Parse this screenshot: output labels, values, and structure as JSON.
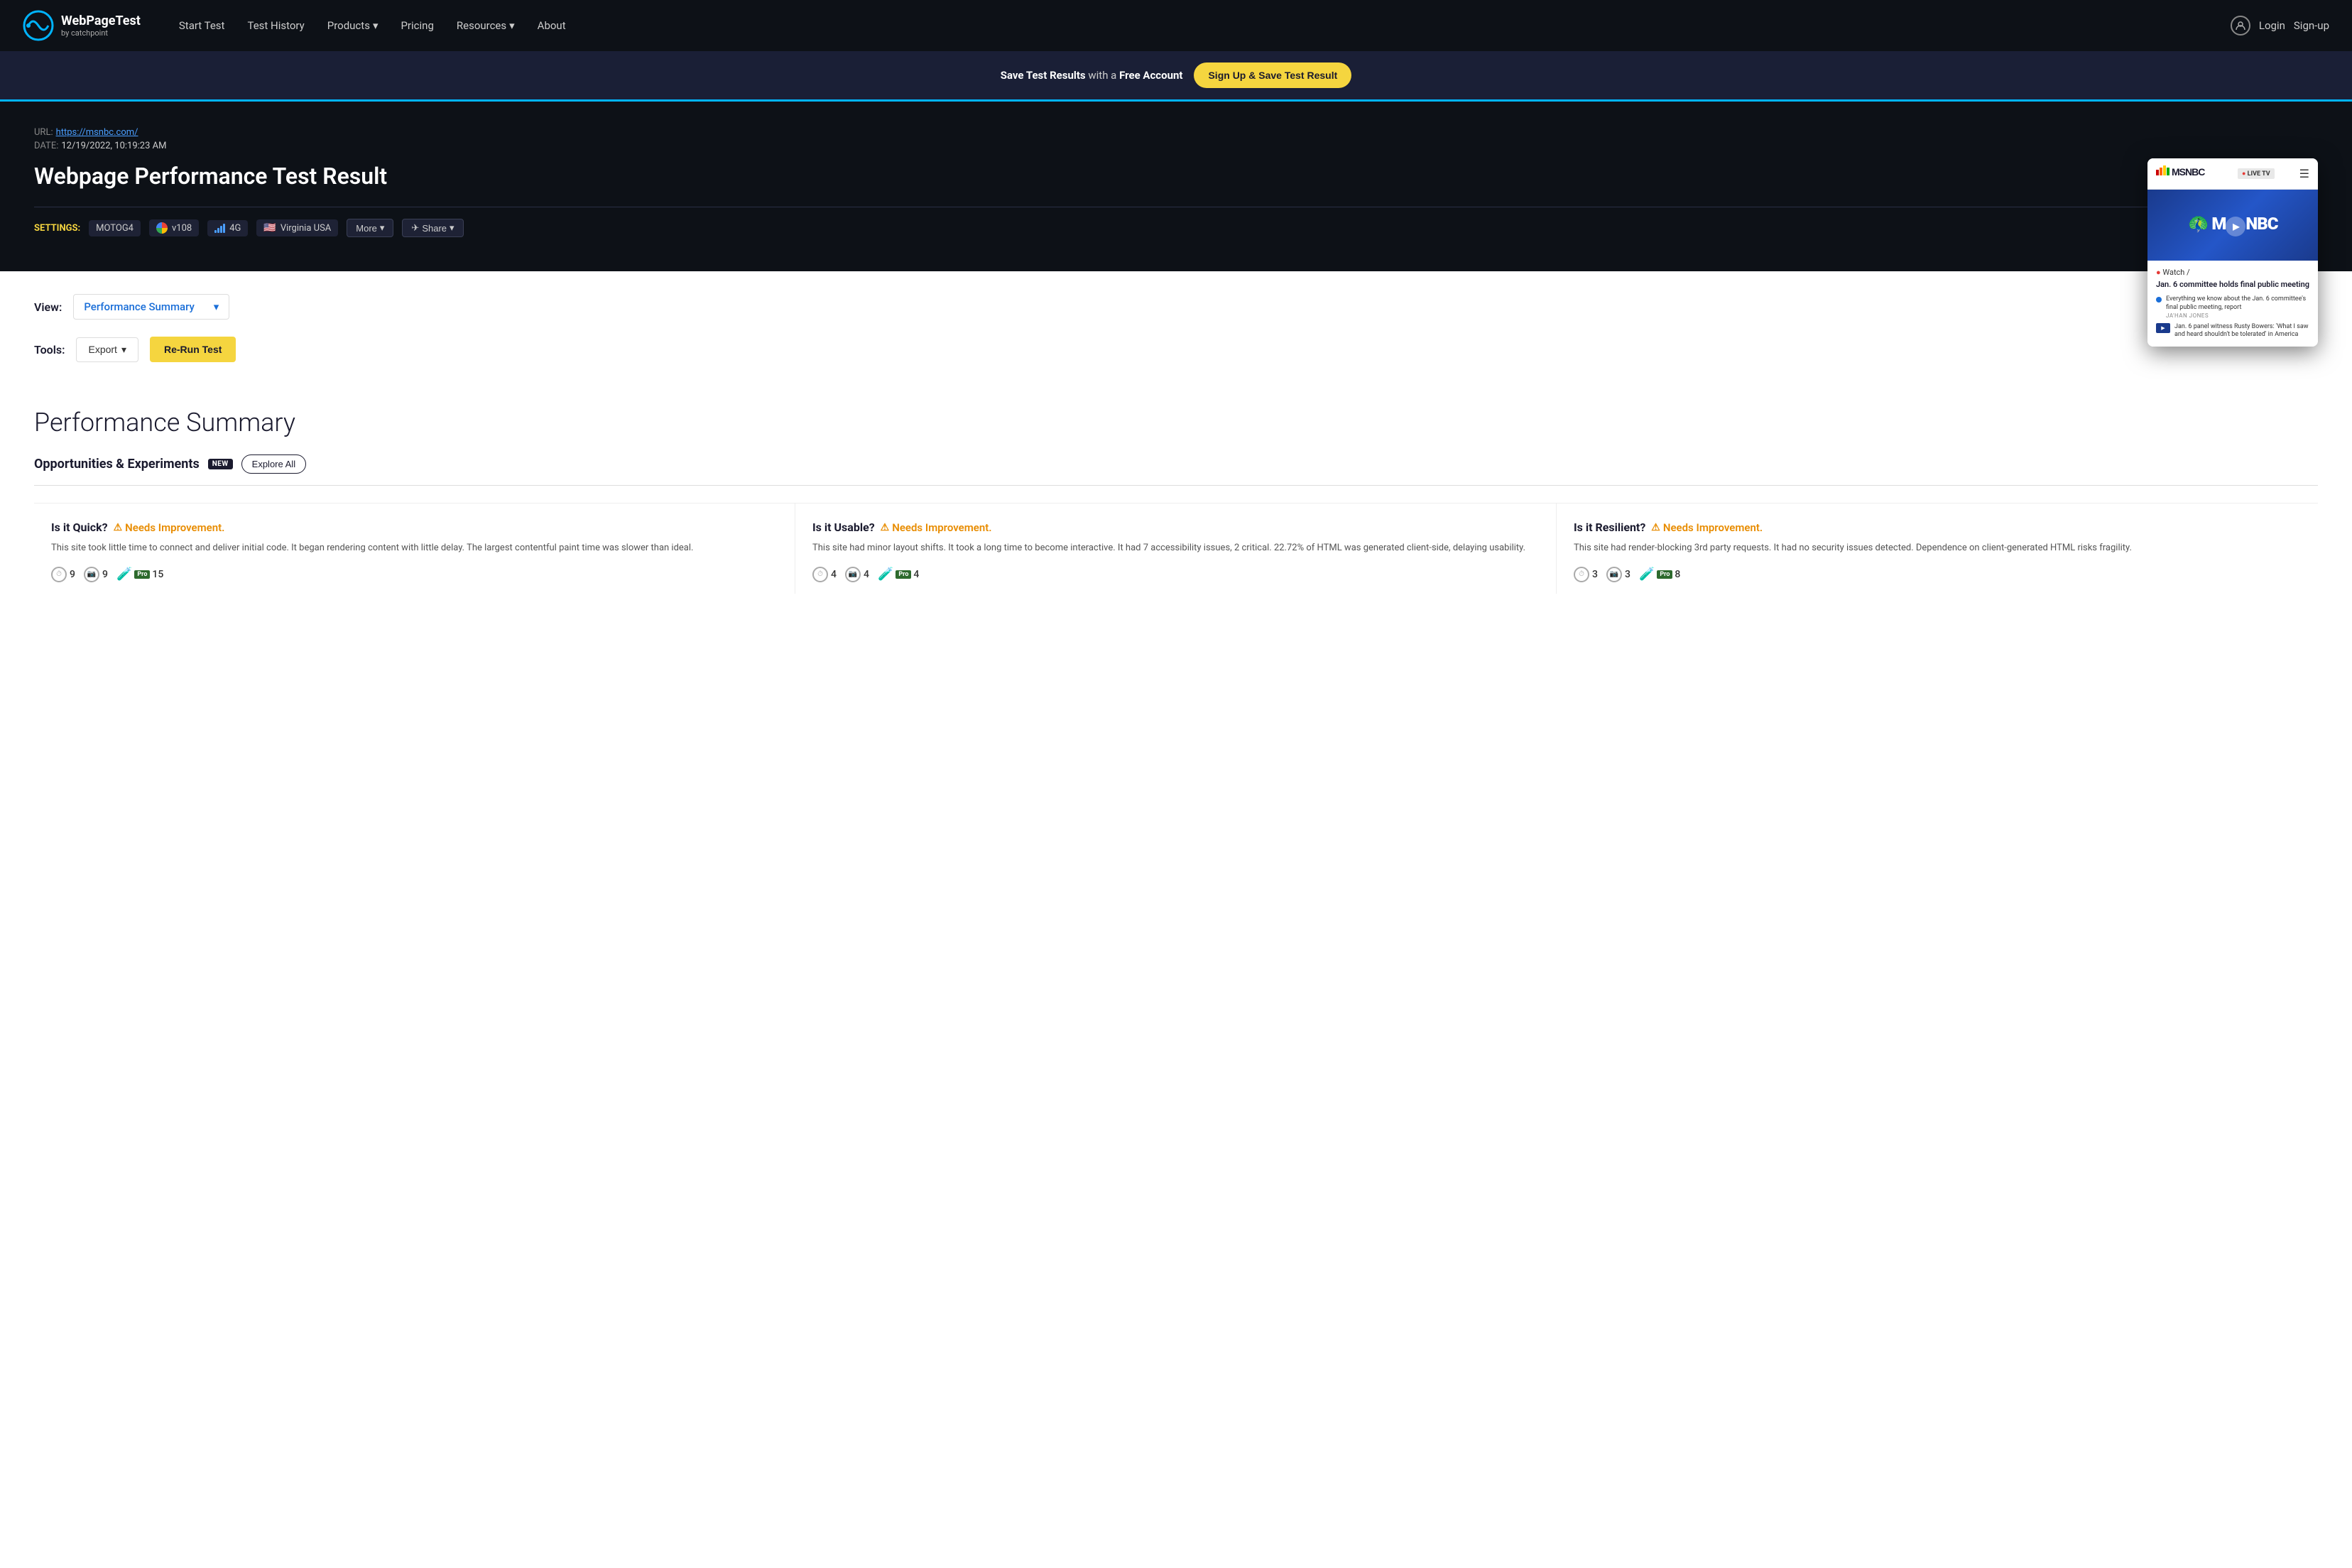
{
  "navbar": {
    "brand": "WebPageTest",
    "sub": "by catchpoint",
    "links": [
      {
        "label": "Start Test",
        "id": "start-test",
        "hasDropdown": false
      },
      {
        "label": "Test History",
        "id": "test-history",
        "hasDropdown": false
      },
      {
        "label": "Products",
        "id": "products",
        "hasDropdown": true
      },
      {
        "label": "Pricing",
        "id": "pricing",
        "hasDropdown": false
      },
      {
        "label": "Resources",
        "id": "resources",
        "hasDropdown": true
      },
      {
        "label": "About",
        "id": "about",
        "hasDropdown": false
      }
    ],
    "login_label": "Login",
    "signup_label": "Sign-up"
  },
  "banner": {
    "text_pre": "Save Test Results",
    "text_mid": " with a ",
    "text_bold": "Free Account",
    "btn_label": "Sign Up & Save Test Result"
  },
  "test_result": {
    "url_label": "URL:",
    "url_value": "https://msnbc.com/",
    "date_label": "DATE:",
    "date_value": "12/19/2022, 10:19:23 AM",
    "page_title": "Webpage Performance Test Result",
    "settings_label": "SETTINGS:",
    "device": "MOTOG4",
    "browser_version": "v108",
    "connection": "4G",
    "location": "Virginia USA",
    "more_label": "More",
    "share_label": "Share"
  },
  "view_section": {
    "view_label": "View:",
    "view_selected": "Performance Summary",
    "tools_label": "Tools:",
    "export_label": "Export",
    "rerun_label": "Re-Run Test"
  },
  "performance_summary": {
    "title": "Performance Summary",
    "opportunities_title": "Opportunities & Experiments",
    "new_badge": "NEW",
    "explore_btn": "Explore All",
    "cards": [
      {
        "title": "Is it Quick?",
        "status": "Needs Improvement.",
        "description": "This site took little time to connect and deliver initial code. It began rendering content with little delay. The largest contentful paint time was slower than ideal.",
        "metrics": [
          {
            "icon": "⏱",
            "count": "9"
          },
          {
            "icon": "📷",
            "count": "9"
          },
          {
            "icon": "🧪",
            "pro": true,
            "count": "15"
          }
        ]
      },
      {
        "title": "Is it Usable?",
        "status": "Needs Improvement.",
        "description": "This site had minor layout shifts. It took a long time to become interactive. It had 7 accessibility issues, 2 critical. 22.72% of HTML was generated client-side, delaying usability.",
        "metrics": [
          {
            "icon": "⏱",
            "count": "4"
          },
          {
            "icon": "📷",
            "count": "4"
          },
          {
            "icon": "🧪",
            "pro": true,
            "count": "4"
          }
        ]
      },
      {
        "title": "Is it Resilient?",
        "status": "Needs Improvement.",
        "description": "This site had render-blocking 3rd party requests. It had no security issues detected. Dependence on client-generated HTML risks fragility.",
        "metrics": [
          {
            "icon": "⏱",
            "count": "3"
          },
          {
            "icon": "📷",
            "count": "3"
          },
          {
            "icon": "🧪",
            "pro": true,
            "count": "8"
          }
        ]
      }
    ]
  },
  "preview": {
    "site_name": "MSNBC",
    "live_tv": "LIVE TV",
    "breaking_label": "Watch /",
    "breaking_headline": "Jan. 6 committee holds final public meeting",
    "article1_text": "Everything we know about the Jan. 6 committee's final public meeting, report",
    "article1_author": "JA'HAN JONES",
    "video_text": "Jan. 6 panel witness Rusty Bowers: 'What I saw and heard shouldn't be tolerated' in America"
  }
}
